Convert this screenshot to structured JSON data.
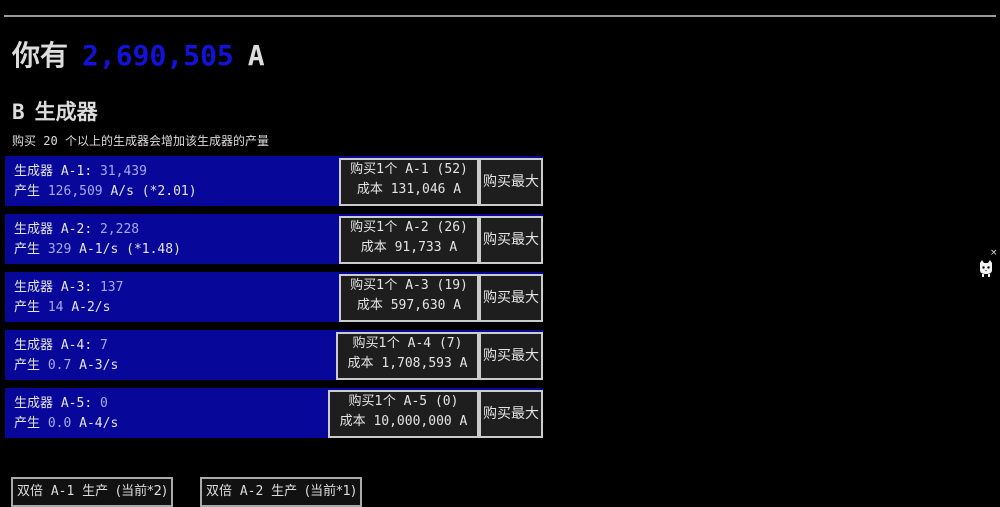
{
  "header": {
    "prefix": "你有",
    "amount": "2,690,505",
    "unit": "A"
  },
  "section": {
    "letter": "B",
    "title": "生成器",
    "hint_prefix": "购买",
    "hint_number": "20",
    "hint_suffix": "个以上的生成器会增加该生成器的产量"
  },
  "generators": [
    {
      "label_cn": "生成器",
      "name": "A-1:",
      "count": "31,439",
      "prod_cn": "产生",
      "prod_value": "126,509",
      "prod_unit": "A/s (*2.01)",
      "buy_cn": "购买1个",
      "buy_text": "A-1 (52)",
      "cost_cn": "成本",
      "cost_text": "131,046 A",
      "max_label": "购买最大"
    },
    {
      "label_cn": "生成器",
      "name": "A-2:",
      "count": "2,228",
      "prod_cn": "产生",
      "prod_value": "329",
      "prod_unit": "A-1/s (*1.48)",
      "buy_cn": "购买1个",
      "buy_text": "A-2 (26)",
      "cost_cn": "成本",
      "cost_text": "91,733 A",
      "max_label": "购买最大"
    },
    {
      "label_cn": "生成器",
      "name": "A-3:",
      "count": "137",
      "prod_cn": "产生",
      "prod_value": "14",
      "prod_unit": "A-2/s",
      "buy_cn": "购买1个",
      "buy_text": "A-3 (19)",
      "cost_cn": "成本",
      "cost_text": "597,630 A",
      "max_label": "购买最大"
    },
    {
      "label_cn": "生成器",
      "name": "A-4:",
      "count": "7",
      "prod_cn": "产生",
      "prod_value": "0.7",
      "prod_unit": "A-3/s",
      "buy_cn": "购买1个",
      "buy_text": "A-4 (7)",
      "cost_cn": "成本",
      "cost_text": "1,708,593 A",
      "max_label": "购买最大"
    },
    {
      "label_cn": "生成器",
      "name": "A-5:",
      "count": "0",
      "prod_cn": "产生",
      "prod_value": "0.0",
      "prod_unit": "A-4/s",
      "buy_cn": "购买1个",
      "buy_text": "A-5 (0)",
      "cost_cn": "成本",
      "cost_text": "10,000,000 A",
      "max_label": "购买最大"
    }
  ],
  "doubles": [
    {
      "cn_a": "双倍",
      "target": "A-1",
      "cn_b": "生产",
      "current": "(当前*2)"
    },
    {
      "cn_a": "双倍",
      "target": "A-2",
      "cn_b": "生产",
      "current": "(当前*1)"
    }
  ],
  "side_widget": {
    "icon": "cat-icon",
    "close": "×"
  }
}
